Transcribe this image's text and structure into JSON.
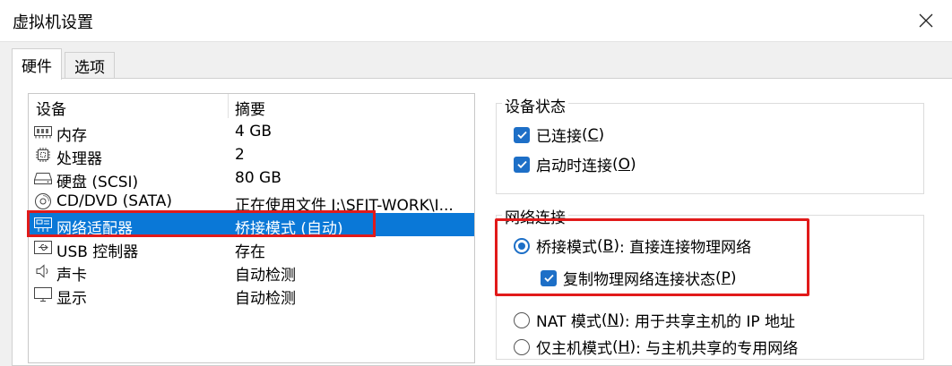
{
  "window": {
    "title": "虚拟机设置"
  },
  "tabs": [
    {
      "label": "硬件"
    },
    {
      "label": "选项"
    }
  ],
  "device_list": {
    "headers": {
      "device": "设备",
      "summary": "摘要"
    },
    "rows": [
      {
        "name": "内存",
        "summary": "4 GB",
        "icon": "memory-icon"
      },
      {
        "name": "处理器",
        "summary": "2",
        "icon": "processor-icon"
      },
      {
        "name": "硬盘 (SCSI)",
        "summary": "80 GB",
        "icon": "hard-disk-icon"
      },
      {
        "name": "CD/DVD (SATA)",
        "summary": "正在使用文件 J:\\SFIT-WORK\\I...",
        "icon": "cd-dvd-icon"
      },
      {
        "name": "网络适配器",
        "summary": "桥接模式 (自动)",
        "icon": "network-adapter-icon",
        "selected": true
      },
      {
        "name": "USB 控制器",
        "summary": "存在",
        "icon": "usb-controller-icon"
      },
      {
        "name": "声卡",
        "summary": "自动检测",
        "icon": "sound-card-icon"
      },
      {
        "name": "显示",
        "summary": "自动检测",
        "icon": "display-icon"
      }
    ]
  },
  "device_status": {
    "title": "设备状态",
    "connected": {
      "label": "已连接",
      "key": "C",
      "checked": true
    },
    "connect_at_power_on": {
      "label": "启动时连接",
      "key": "O",
      "checked": true
    }
  },
  "network_connection": {
    "title": "网络连接",
    "bridged": {
      "label": "桥接模式",
      "key": "B",
      "desc": ": 直接连接物理网络",
      "selected": true
    },
    "replicate": {
      "label": "复制物理网络连接状态",
      "key": "P",
      "checked": true
    },
    "nat": {
      "label": "NAT 模式",
      "key": "N",
      "desc": ": 用于共享主机的 IP 地址",
      "selected": false
    },
    "host_only": {
      "label": "仅主机模式",
      "key": "H",
      "desc": ": 与主机共享的专用网络",
      "selected": false
    }
  },
  "colors": {
    "selection": "#0a78d7",
    "accent": "#1d6fc7",
    "highlight_box": "#e11a1a"
  }
}
